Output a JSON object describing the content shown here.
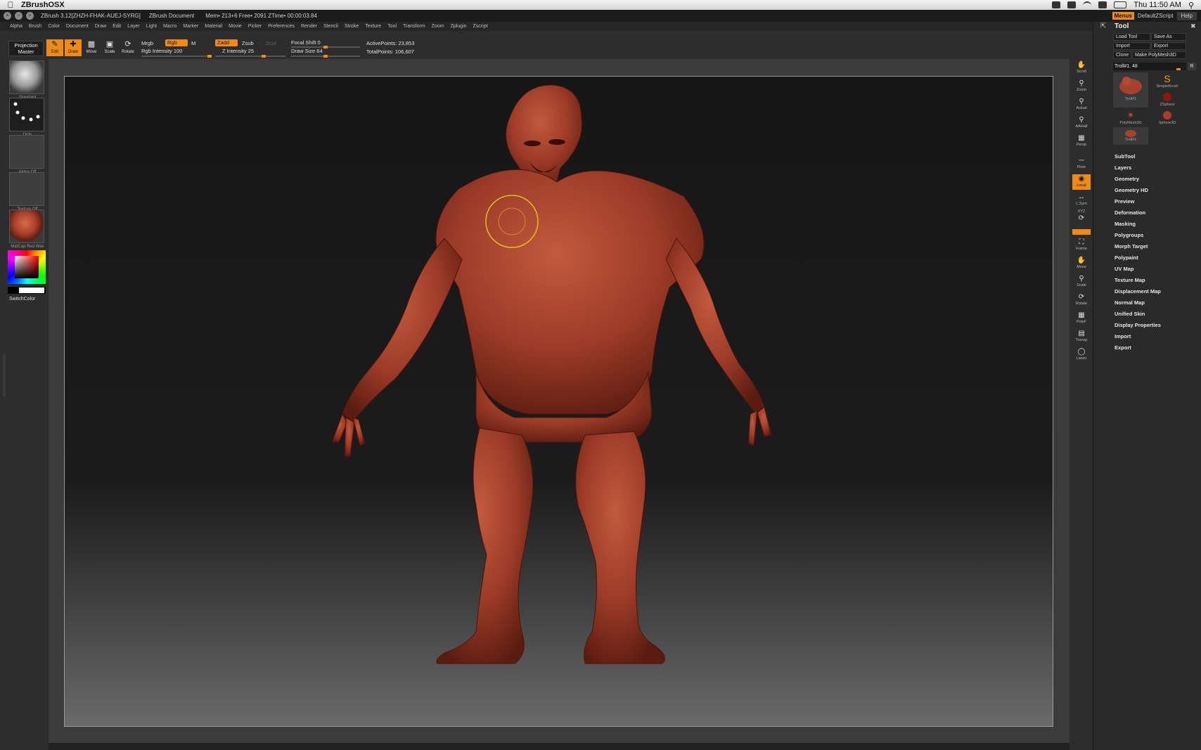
{
  "macos": {
    "app_name": "ZBrushOSX",
    "clock": "Thu 11:50 AM"
  },
  "titlebar": {
    "title": "ZBrush 3.12[ZHZH-FHAK-AUEJ-SYRG]",
    "document": "ZBrush Document",
    "mem_info": "Mem• 213+6 Free• 2091 ZTime• 00:00:03.84",
    "menus_label": "Menus",
    "default_script": "DefaultZScript",
    "help_label": "Help"
  },
  "menubar": [
    "Alpha",
    "Brush",
    "Color",
    "Document",
    "Draw",
    "Edit",
    "Layer",
    "Light",
    "Macro",
    "Marker",
    "Material",
    "Movie",
    "Picker",
    "Preferences",
    "Render",
    "Stencil",
    "Stroke",
    "Texture",
    "Tool",
    "Transform",
    "Zoom",
    "Zplugin",
    "Zscript"
  ],
  "toolbar": {
    "projection_master": [
      "Projection",
      "Master"
    ],
    "edit_label": "Edit",
    "draw_label": "Draw",
    "move_label": "Move",
    "scale_label": "Scale",
    "rotate_label": "Rotate",
    "mrgb": "Mrgb",
    "rgb": "Rgb",
    "m": "M",
    "rgb_intensity_label": "Rgb Intensity",
    "rgb_intensity": "100",
    "zadd": "Zadd",
    "zsub": "Zsub",
    "zcut": "Zcut",
    "z_intensity_label": "Z Intensity",
    "z_intensity": "25",
    "focal_shift_label": "Focal Shift",
    "focal_shift": "0",
    "draw_size_label": "Draw Size",
    "draw_size": "64",
    "active_points": "ActivePoints: 23,853",
    "total_points": "TotalPoints: 106,607"
  },
  "left_shelf": {
    "brush": "Standard",
    "stroke": "Dots",
    "alpha": "Alpha Off",
    "texture": "Texture Off",
    "material": "MatCap Red Wax",
    "switch_color": "SwitchColor"
  },
  "right_shelf": [
    "Scroll",
    "Zoom",
    "Actual",
    "AAHalf",
    "Persp",
    "Floor",
    "Local",
    "L.Sym",
    "XYZ",
    "Frame",
    "Move",
    "Scale",
    "Rotate",
    "PolyF",
    "Transp",
    "Lasso"
  ],
  "tool_panel": {
    "title": "Tool",
    "load_tool": "Load Tool",
    "save_as": "Save As",
    "import": "Import",
    "export": "Export",
    "clone": "Clone",
    "make_polymesh": "Make PolyMesh3D",
    "current_tool": "Troll#1. 48",
    "r_label": "R",
    "thumbs": [
      {
        "label": "Troll#1"
      },
      {
        "label": "SimpleBrush"
      },
      {
        "label": "ZSphere"
      },
      {
        "label": "PolyMesh3D"
      },
      {
        "label": "Sphere3D"
      },
      {
        "label": "Troll#1"
      }
    ],
    "menus": [
      "SubTool",
      "Layers",
      "Geometry",
      "Geometry HD",
      "Preview",
      "Deformation",
      "Masking",
      "Polygroups",
      "Morph Target",
      "Polypaint",
      "UV Map",
      "Texture Map",
      "Displacement Map",
      "Normal Map",
      "Unified Skin",
      "Display Properties",
      "Import",
      "Export"
    ]
  },
  "colors": {
    "accent": "#f08a16",
    "model": "#a8412c",
    "cursor": "#e0c020"
  }
}
